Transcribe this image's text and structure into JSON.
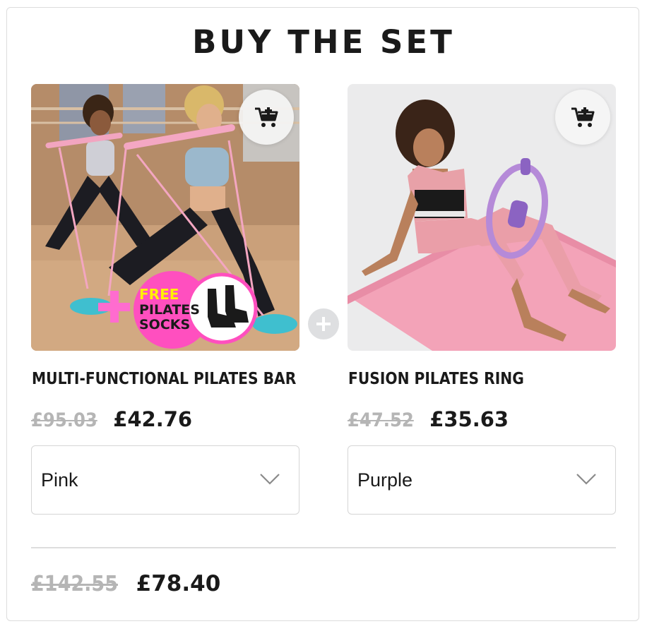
{
  "section": {
    "title": "BUY THE SET"
  },
  "products": [
    {
      "name": "MULTI-FUNCTIONAL PILATES BAR",
      "old_price": "£95.03",
      "price": "£42.76",
      "variant": "Pink",
      "image_overlay": {
        "line1": "FREE",
        "line2": "PILATES",
        "line3": "SOCKS"
      },
      "cart_icon": "add-to-cart-icon"
    },
    {
      "name": "FUSION PILATES RING",
      "old_price": "£47.52",
      "price": "£35.63",
      "variant": "Purple",
      "cart_icon": "add-to-cart-icon"
    }
  ],
  "bundle": {
    "old_total": "£142.55",
    "total": "£78.40"
  },
  "colors": {
    "text": "#1a1a1a",
    "muted": "#b5b5b5",
    "border": "#d5d5d5",
    "accent_pink": "#ff4fbf",
    "accent_yellow": "#fff200"
  }
}
